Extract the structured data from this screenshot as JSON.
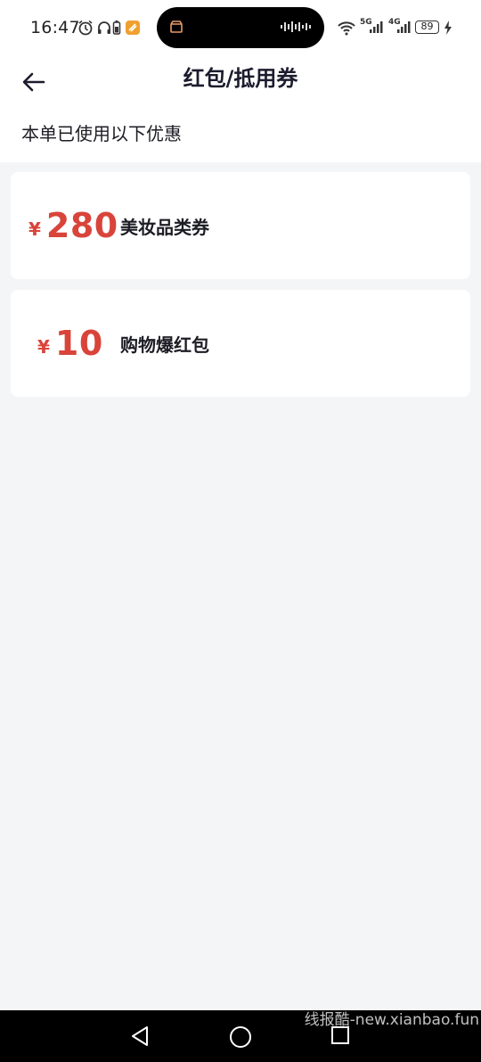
{
  "status_bar": {
    "time": "16:47",
    "battery": "89",
    "network_1": "5G",
    "network_2": "4G"
  },
  "header": {
    "title": "红包/抵用券",
    "subtitle": "本单已使用以下优惠"
  },
  "coupons": [
    {
      "currency": "¥",
      "amount": "280",
      "name": "美妆品类券"
    },
    {
      "currency": "¥",
      "amount": "10",
      "name": "购物爆红包"
    }
  ],
  "watermark": "线报酷-new.xianbao.fun",
  "colors": {
    "accent_red": "#d9443a",
    "page_bg": "#f4f5f7",
    "card_bg": "#ffffff"
  }
}
